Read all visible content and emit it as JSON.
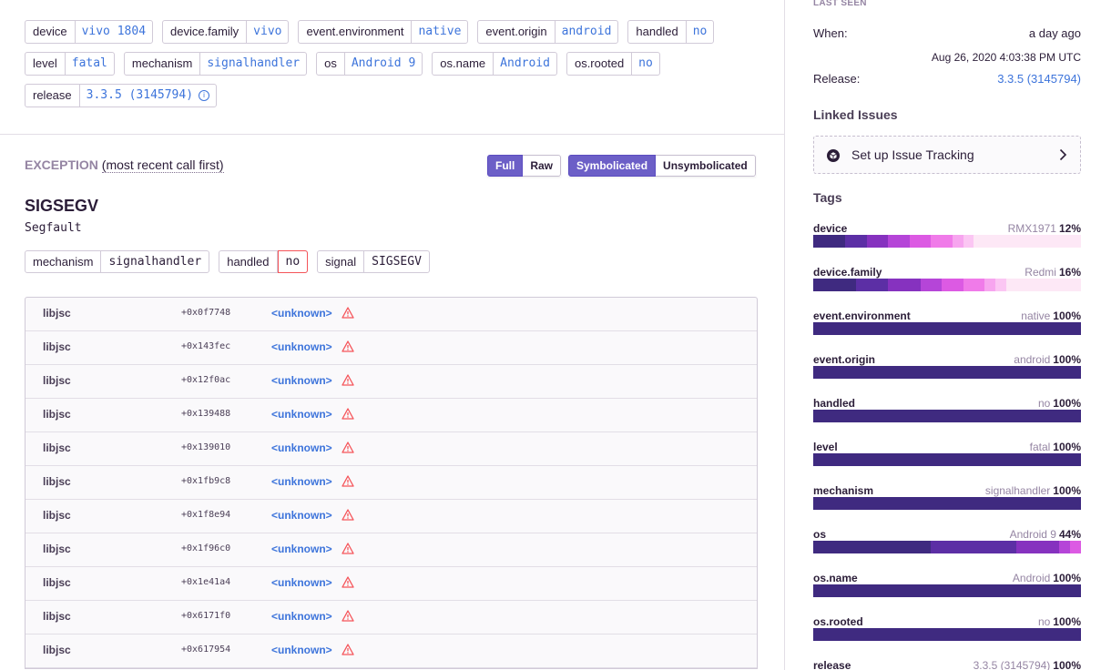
{
  "event_tags": [
    [
      {
        "key": "device",
        "value": "vivo 1804"
      },
      {
        "key": "device.family",
        "value": "vivo"
      },
      {
        "key": "event.environment",
        "value": "native"
      },
      {
        "key": "event.origin",
        "value": "android"
      },
      {
        "key": "handled",
        "value": "no"
      }
    ],
    [
      {
        "key": "level",
        "value": "fatal"
      },
      {
        "key": "mechanism",
        "value": "signalhandler"
      },
      {
        "key": "os",
        "value": "Android 9"
      },
      {
        "key": "os.name",
        "value": "Android"
      },
      {
        "key": "os.rooted",
        "value": "no"
      }
    ],
    [
      {
        "key": "release",
        "value": "3.3.5 (3145794)",
        "info_icon": "info-icon"
      }
    ]
  ],
  "exception": {
    "title": "EXCEPTION",
    "subtitle": "(most recent call first)",
    "view_buttons": [
      "Full",
      "Raw"
    ],
    "symbol_buttons": [
      "Symbolicated",
      "Unsymbolicated"
    ],
    "active_view": "Full",
    "active_symbol": "Symbolicated",
    "signal_name": "SIGSEGV",
    "signal_desc": "Segfault",
    "mechanism_tags": [
      {
        "key": "mechanism",
        "value": "signalhandler",
        "status": "normal"
      },
      {
        "key": "handled",
        "value": "no",
        "status": "error"
      },
      {
        "key": "signal",
        "value": "SIGSEGV",
        "status": "normal"
      }
    ],
    "frames": [
      {
        "package": "libjsc",
        "address": "+0x0f7748",
        "function": "<unknown>"
      },
      {
        "package": "libjsc",
        "address": "+0x143fec",
        "function": "<unknown>"
      },
      {
        "package": "libjsc",
        "address": "+0x12f0ac",
        "function": "<unknown>"
      },
      {
        "package": "libjsc",
        "address": "+0x139488",
        "function": "<unknown>"
      },
      {
        "package": "libjsc",
        "address": "+0x139010",
        "function": "<unknown>"
      },
      {
        "package": "libjsc",
        "address": "+0x1fb9c8",
        "function": "<unknown>"
      },
      {
        "package": "libjsc",
        "address": "+0x1f8e94",
        "function": "<unknown>"
      },
      {
        "package": "libjsc",
        "address": "+0x1f96c0",
        "function": "<unknown>"
      },
      {
        "package": "libjsc",
        "address": "+0x1e41a4",
        "function": "<unknown>"
      },
      {
        "package": "libjsc",
        "address": "+0x6171f0",
        "function": "<unknown>"
      },
      {
        "package": "libjsc",
        "address": "+0x617954",
        "function": "<unknown>"
      }
    ],
    "frame_icon": "warning-icon"
  },
  "sidebar": {
    "last_seen_label": "LAST SEEN",
    "when_label": "When:",
    "when_value": "a day ago",
    "date_value": "Aug 26, 2020 4:03:38 PM UTC",
    "release_label": "Release:",
    "release_value": "3.3.5 (3145794)",
    "linked_issues_title": "Linked Issues",
    "issue_tracking_label": "Set up Issue Tracking",
    "tags_title": "Tags",
    "tag_distribution": [
      {
        "name": "device",
        "top_value": "RMX1971",
        "top_percent": "12%",
        "segments": [
          12,
          8,
          8,
          8,
          8,
          8,
          4,
          4
        ]
      },
      {
        "name": "device.family",
        "top_value": "Redmi",
        "top_percent": "16%",
        "segments": [
          16,
          12,
          12,
          8,
          8,
          8,
          4,
          4
        ]
      },
      {
        "name": "event.environment",
        "top_value": "native",
        "top_percent": "100%",
        "segments": [
          100
        ]
      },
      {
        "name": "event.origin",
        "top_value": "android",
        "top_percent": "100%",
        "segments": [
          100
        ]
      },
      {
        "name": "handled",
        "top_value": "no",
        "top_percent": "100%",
        "segments": [
          100
        ]
      },
      {
        "name": "level",
        "top_value": "fatal",
        "top_percent": "100%",
        "segments": [
          100
        ]
      },
      {
        "name": "mechanism",
        "top_value": "signalhandler",
        "top_percent": "100%",
        "segments": [
          100
        ]
      },
      {
        "name": "os",
        "top_value": "Android 9",
        "top_percent": "44%",
        "segments": [
          44,
          32,
          16,
          4,
          4
        ]
      },
      {
        "name": "os.name",
        "top_value": "Android",
        "top_percent": "100%",
        "segments": [
          100
        ]
      },
      {
        "name": "os.rooted",
        "top_value": "no",
        "top_percent": "100%",
        "segments": [
          100
        ]
      },
      {
        "name": "release",
        "top_value": "3.3.5 (3145794)",
        "top_percent": "100%",
        "segments": [
          100
        ]
      }
    ],
    "segment_colors": [
      "#3f2a80",
      "#5c2fa5",
      "#8632bf",
      "#b545d8",
      "#dc5ae3",
      "#f07be9",
      "#f7a5ef",
      "#fbc6f3"
    ]
  }
}
